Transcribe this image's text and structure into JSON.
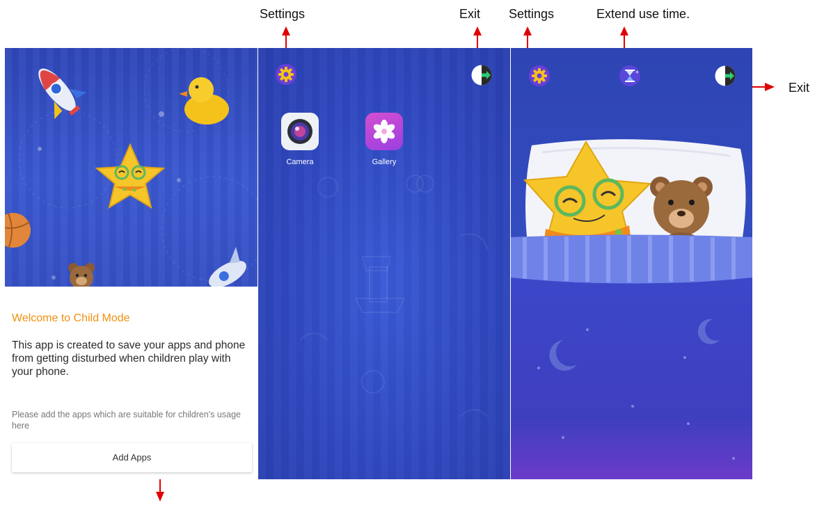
{
  "annotations": {
    "settings_left": "Settings",
    "exit_mid": "Exit",
    "settings_right": "Settings",
    "extend_time": "Extend use time.",
    "exit_right": "Exit"
  },
  "welcome_screen": {
    "title": "Welcome to Child Mode",
    "body": "This app is created to save your apps and phone from getting disturbed when children play with your phone.",
    "note": "Please add the apps which are suitable for children's usage here",
    "add_apps_label": "Add Apps"
  },
  "home_screen": {
    "apps": [
      {
        "label": "Camera",
        "icon": "camera-icon"
      },
      {
        "label": "Gallery",
        "icon": "gallery-icon"
      }
    ],
    "settings_icon": "gear-icon",
    "exit_icon": "exit-icon"
  },
  "sleep_screen": {
    "settings_icon": "gear-icon",
    "extend_icon": "hourglass-icon",
    "exit_icon": "exit-icon"
  },
  "colors": {
    "accent_orange": "#f0900f",
    "screen_blue": "#3550c4",
    "arrow_red": "#e00000",
    "settings_purple": "#6a3fd6",
    "gear_yellow": "#f5c21b"
  }
}
